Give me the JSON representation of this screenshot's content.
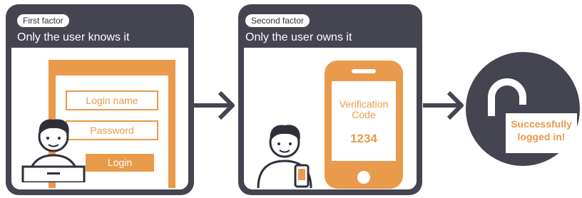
{
  "first_factor": {
    "tag": "First factor",
    "description": "Only the user knows it",
    "login_name_label": "Login name",
    "password_label": "Password",
    "login_button_label": "Login"
  },
  "second_factor": {
    "tag": "Second factor",
    "description": "Only the user owns it",
    "verification_label": "Verification Code",
    "verification_code": "1234"
  },
  "result": {
    "label": "Successfully logged in!"
  },
  "colors": {
    "panel": "#454451",
    "accent": "#e99a4b",
    "background": "#ffffff"
  },
  "icons": [
    "user-at-laptop-icon",
    "user-with-phone-icon",
    "smartphone-icon",
    "arrow-right-icon",
    "unlocked-padlock-icon"
  ]
}
